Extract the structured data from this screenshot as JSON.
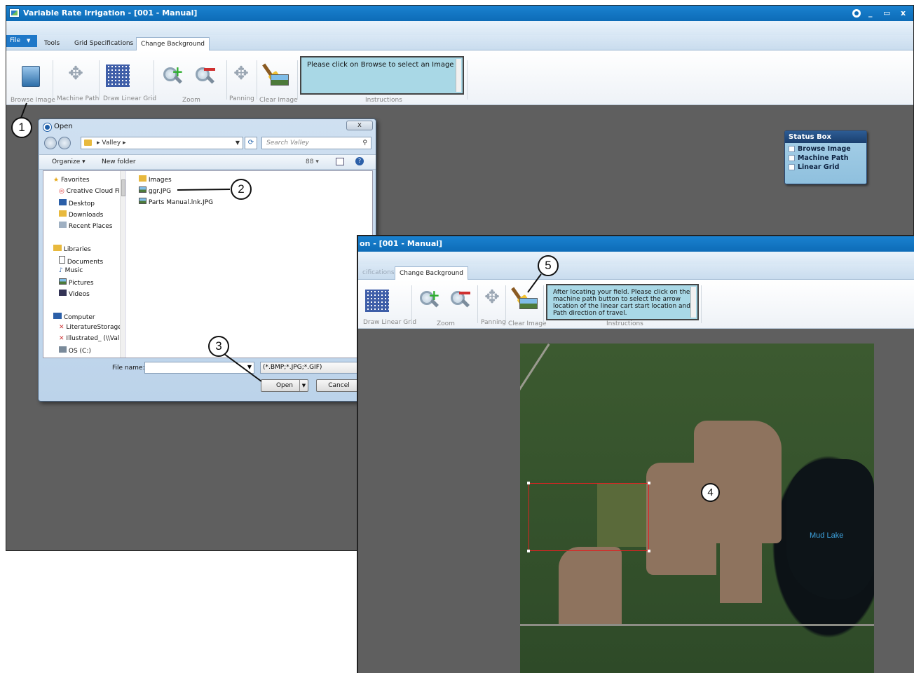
{
  "main_window": {
    "title": "Variable Rate Irrigation - [001 - Manual]",
    "window_controls": {
      "minimize": "_",
      "maximize": "▭",
      "close": "x"
    },
    "menu": {
      "file": "File",
      "file_arrow": "▼"
    },
    "tabs": [
      "Tools",
      "Grid Specifications",
      "Change Background"
    ],
    "active_tab": "Change Background",
    "ribbon": {
      "browse_image": "Browse Image",
      "machine_path": "Machine Path",
      "draw_linear_grid": "Draw Linear Grid",
      "zoom": "Zoom",
      "panning": "Panning",
      "clear_image": "Clear Image",
      "instructions_group": "Instructions",
      "instructions_text": "Please click on Browse to select an Image"
    },
    "status_box": {
      "title": "Status Box",
      "items": [
        "Browse Image",
        "Machine Path",
        "Linear Grid"
      ]
    }
  },
  "open_dialog": {
    "title": "Open",
    "close": "x",
    "address": "Valley",
    "search_placeholder": "Search Valley",
    "organize": "Organize ▾",
    "new_folder": "New folder",
    "view_toggle": "88 ▾",
    "help": "?",
    "nav": {
      "favorites": "Favorites",
      "favorites_items": [
        "Creative Cloud Fi",
        "Desktop",
        "Downloads",
        "Recent Places"
      ],
      "libraries": "Libraries",
      "libraries_items": [
        "Documents",
        "Music",
        "Pictures",
        "Videos"
      ],
      "computer": "Computer",
      "computer_items": [
        "LiteratureStorage",
        "Illustrated_ (\\\\Val",
        "OS (C:)"
      ]
    },
    "files": [
      "Images",
      "ggr.JPG",
      "Parts Manual.lnk.JPG"
    ],
    "file_name_label": "File name:",
    "file_name_value": "",
    "file_type": "(*.BMP;*.JPG;*.GIF)",
    "open_button": "Open",
    "cancel_button": "Cancel"
  },
  "overlay_window": {
    "title": "on - [001 - Manual]",
    "tabs": [
      "cifications",
      "Change Background"
    ],
    "ribbon": {
      "draw_linear_grid": "Draw Linear Grid",
      "zoom": "Zoom",
      "panning": "Panning",
      "clear_image": "Clear Image",
      "instructions_group": "Instructions",
      "instructions_text": "After locating your field. Please click on the machine path button to select the arrow location of the linear cart start location and Path direction of travel."
    },
    "map_label": "Mud Lake"
  },
  "callouts": [
    "1",
    "2",
    "3",
    "4",
    "5"
  ],
  "colors": {
    "titlebar": "#0d6cb7",
    "instructions_bg": "#a9d8e6",
    "workspace": "#5f5f5f",
    "status_header": "#1a3f6e",
    "selection": "#dd2222"
  }
}
